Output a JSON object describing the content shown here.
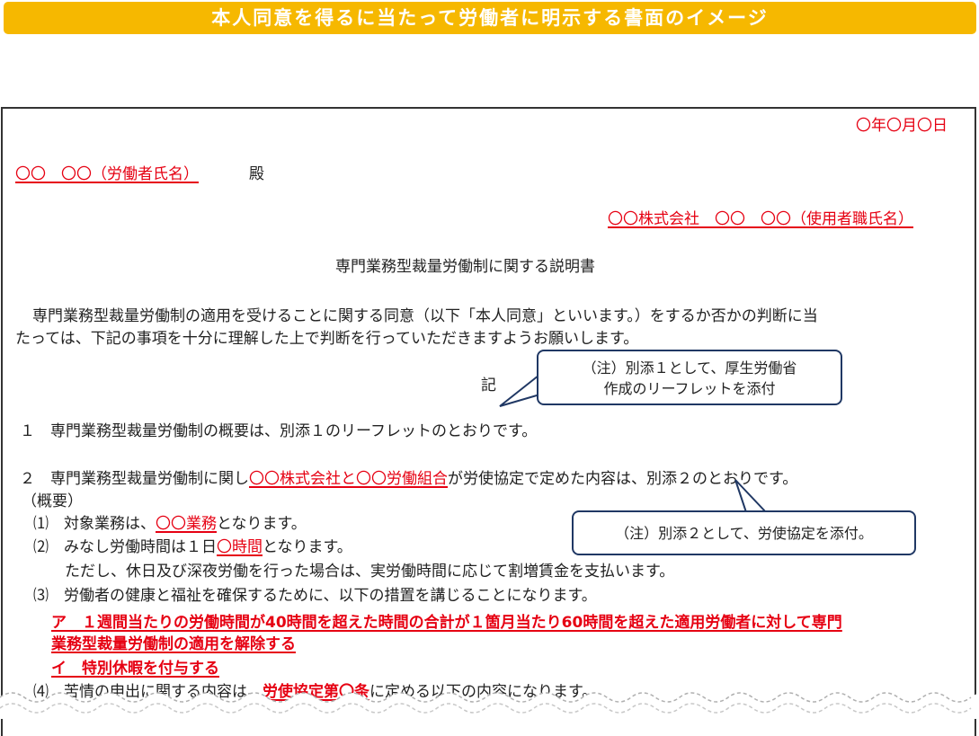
{
  "banner": {
    "title": "本人同意を得るに当たって労働者に明示する書面のイメージ"
  },
  "document": {
    "date": "〇年〇月〇日",
    "addressee": "〇〇　〇〇（労働者氏名）",
    "honorific": "殿",
    "sender": "〇〇株式会社　〇〇　〇〇（使用者職氏名）",
    "title": "専門業務型裁量労働制に関する説明書",
    "intro_line1": "専門業務型裁量労働制の適用を受けることに関する同意（以下「本人同意」といいます。）をするか否かの判断に当",
    "intro_line2": "たっては、下記の事項を十分に理解した上で判断を行っていただきますようお願いします。",
    "ki": "記",
    "item1": "１　専門業務型裁量労働制の概要は、別添１のリーフレットのとおりです。",
    "item2_pre": "２　専門業務型裁量労働制に関し",
    "item2_red": "〇〇株式会社と〇〇労働組合",
    "item2_post": "が労使協定で定めた内容は、別添２のとおりです。",
    "overview_label": "（概要）",
    "sub1_pre": "⑴　対象業務は、",
    "sub1_red": "〇〇業務",
    "sub1_post": "となります。",
    "sub2_pre": "⑵　みなし労働時間は１日",
    "sub2_red": "〇時間",
    "sub2_post": "となります。",
    "sub2_note": "ただし、休日及び深夜労働を行った場合は、実労働時間に応じて割増賃金を支払います。",
    "sub3": "⑶　労働者の健康と福祉を確保するために、以下の措置を講じることになります。",
    "measure_a_line1": "ア　１週間当たりの労働時間が40時間を超えた時間の合計が１箇月当たり60時間を超えた適用労働者に対して専門",
    "measure_a_line2": "業務型裁量労働制の適用を解除する",
    "measure_b": "イ　特別休暇を付与する",
    "sub4_pre": "⑷　苦情の申出に関する内容は、",
    "sub4_red1": "労使協定第",
    "sub4_red2": "〇条",
    "sub4_post": "に定める以下の内容になります。"
  },
  "callouts": {
    "note1_line1": "（注）別添１として、厚生労働省",
    "note1_line2": "作成のリーフレットを添付",
    "note2": "（注）別添２として、労使協定を添付。"
  },
  "colors": {
    "banner": "#f6b800",
    "accent_red": "#e60012",
    "callout_border": "#203864"
  }
}
